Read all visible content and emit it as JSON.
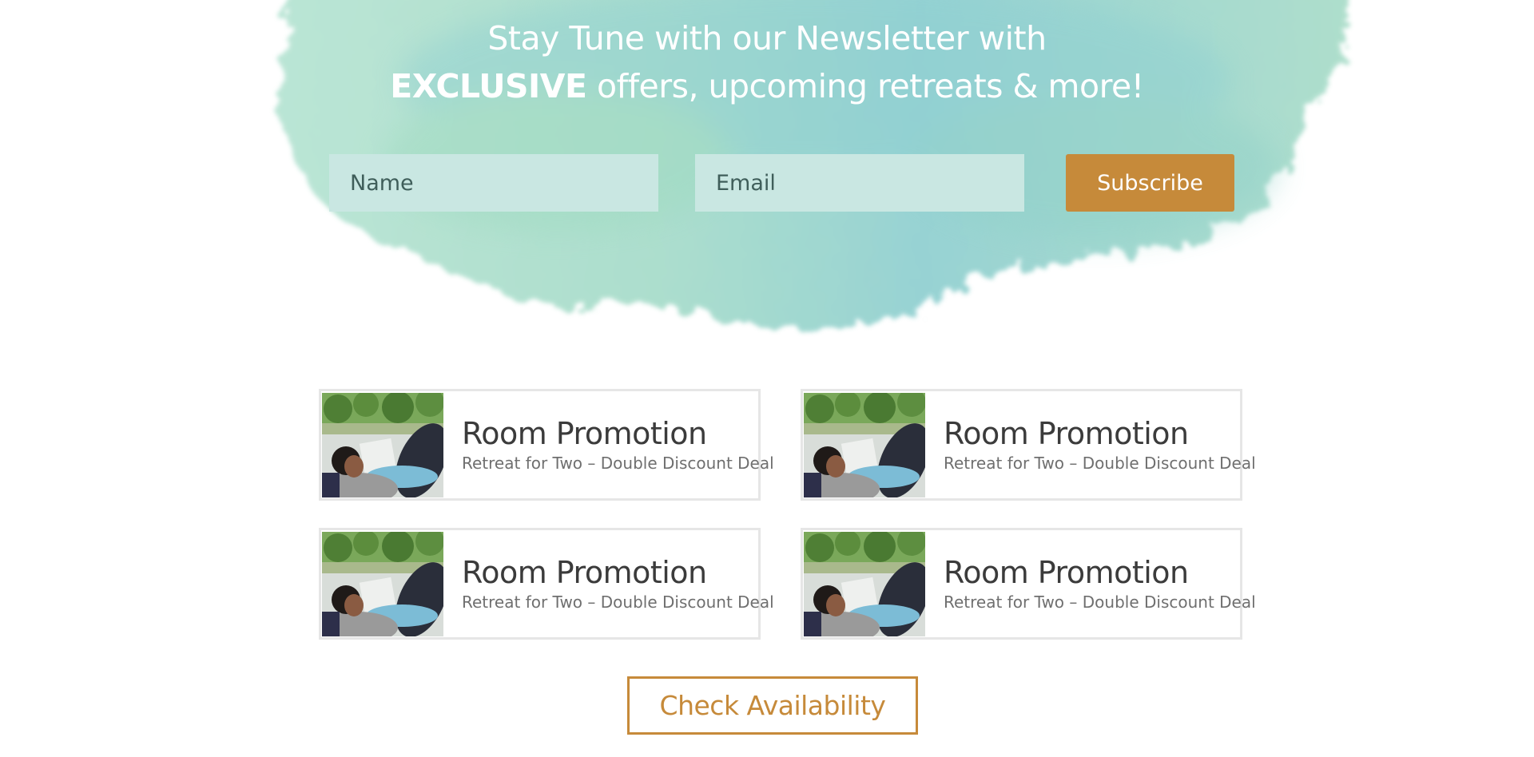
{
  "newsletter": {
    "headline_line1": "Stay Tune with our Newsletter with",
    "headline_strong": "EXCLUSIVE",
    "headline_line2_rest": " offers, upcoming retreats & more!",
    "name_placeholder": "Name",
    "email_placeholder": "Email",
    "subscribe_label": "Subscribe",
    "splash_colors": [
      "#a6dcc9",
      "#8fcfd0",
      "#b5e3d2",
      "#9fd5dd"
    ],
    "accent": "#c68a3a"
  },
  "promotions": [
    {
      "title": "Room Promotion",
      "subtitle": "Retreat for Two – Double Discount Deal"
    },
    {
      "title": "Room Promotion",
      "subtitle": "Retreat for Two – Double Discount Deal"
    },
    {
      "title": "Room Promotion",
      "subtitle": "Retreat for Two – Double Discount Deal"
    },
    {
      "title": "Room Promotion",
      "subtitle": "Retreat for Two – Double Discount Deal"
    }
  ],
  "cta": {
    "check_availability_label": "Check Availability"
  }
}
